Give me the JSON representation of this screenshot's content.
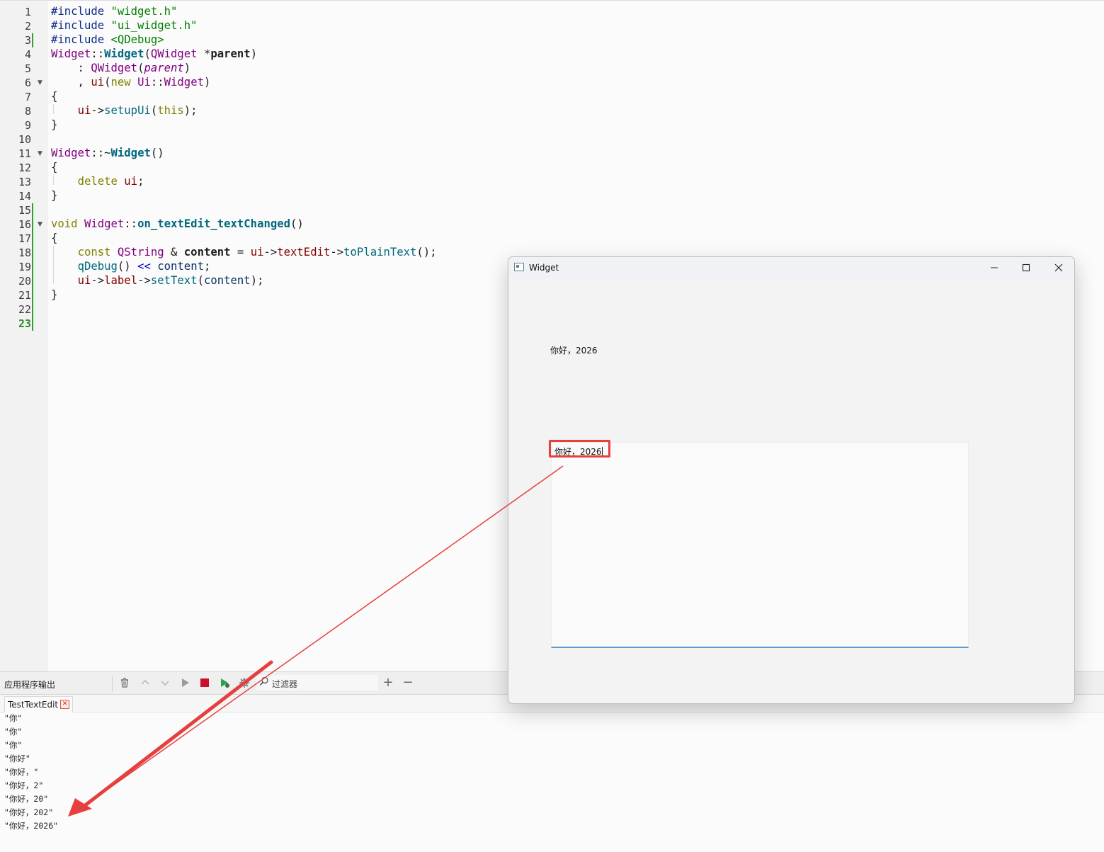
{
  "editor": {
    "line_numbers": [
      "1",
      "2",
      "3",
      "4",
      "5",
      "6",
      "7",
      "8",
      "9",
      "10",
      "11",
      "12",
      "13",
      "14",
      "15",
      "16",
      "17",
      "18",
      "19",
      "20",
      "21",
      "22",
      "23"
    ],
    "lines": [
      [
        {
          "t": "#include ",
          "c": "pp"
        },
        {
          "t": "\"widget.h\"",
          "c": "str"
        }
      ],
      [
        {
          "t": "#include ",
          "c": "pp"
        },
        {
          "t": "\"ui_widget.h\"",
          "c": "str"
        }
      ],
      [
        {
          "t": "#include ",
          "c": "pp"
        },
        {
          "t": "<QDebug>",
          "c": "str"
        }
      ],
      [
        {
          "t": "Widget",
          "c": "cls"
        },
        {
          "t": "::"
        },
        {
          "t": "Widget",
          "c": "fn"
        },
        {
          "t": "("
        },
        {
          "t": "QWidget",
          "c": "cls"
        },
        {
          "t": " *"
        },
        {
          "t": "parent",
          "c": "bold"
        },
        {
          "t": ")"
        }
      ],
      [
        {
          "t": "    : "
        },
        {
          "t": "QWidget",
          "c": "cls"
        },
        {
          "t": "("
        },
        {
          "t": "parent",
          "c": "par"
        },
        {
          "t": ")"
        }
      ],
      [
        {
          "t": "    , "
        },
        {
          "t": "ui",
          "c": "mem"
        },
        {
          "t": "("
        },
        {
          "t": "new",
          "c": "kw"
        },
        {
          "t": " "
        },
        {
          "t": "Ui",
          "c": "cls"
        },
        {
          "t": "::"
        },
        {
          "t": "Widget",
          "c": "cls"
        },
        {
          "t": ")"
        }
      ],
      [
        {
          "t": "{"
        }
      ],
      [
        {
          "t": "    "
        },
        {
          "t": "ui",
          "c": "mem"
        },
        {
          "t": "->"
        },
        {
          "t": "setupUi",
          "c": "fnc"
        },
        {
          "t": "("
        },
        {
          "t": "this",
          "c": "kw"
        },
        {
          "t": ");"
        }
      ],
      [
        {
          "t": "}"
        }
      ],
      [
        {
          "t": ""
        }
      ],
      [
        {
          "t": "Widget",
          "c": "cls"
        },
        {
          "t": "::~"
        },
        {
          "t": "Widget",
          "c": "fn"
        },
        {
          "t": "()"
        }
      ],
      [
        {
          "t": "{"
        }
      ],
      [
        {
          "t": "    "
        },
        {
          "t": "delete",
          "c": "kw"
        },
        {
          "t": " "
        },
        {
          "t": "ui",
          "c": "mem"
        },
        {
          "t": ";"
        }
      ],
      [
        {
          "t": "}"
        }
      ],
      [
        {
          "t": ""
        }
      ],
      [
        {
          "t": "void",
          "c": "kw"
        },
        {
          "t": " "
        },
        {
          "t": "Widget",
          "c": "cls"
        },
        {
          "t": "::"
        },
        {
          "t": "on_textEdit_textChanged",
          "c": "fn"
        },
        {
          "t": "()"
        }
      ],
      [
        {
          "t": "{"
        }
      ],
      [
        {
          "t": "    "
        },
        {
          "t": "const",
          "c": "kw"
        },
        {
          "t": " "
        },
        {
          "t": "QString",
          "c": "cls"
        },
        {
          "t": " & "
        },
        {
          "t": "content",
          "c": "bold"
        },
        {
          "t": " = "
        },
        {
          "t": "ui",
          "c": "mem"
        },
        {
          "t": "->"
        },
        {
          "t": "textEdit",
          "c": "mem"
        },
        {
          "t": "->"
        },
        {
          "t": "toPlainText",
          "c": "fnc"
        },
        {
          "t": "();"
        }
      ],
      [
        {
          "t": "    "
        },
        {
          "t": "qDebug",
          "c": "fnc"
        },
        {
          "t": "() "
        },
        {
          "t": "<<",
          "c": "op"
        },
        {
          "t": " "
        },
        {
          "t": "content",
          "c": "loc"
        },
        {
          "t": ";"
        }
      ],
      [
        {
          "t": "    "
        },
        {
          "t": "ui",
          "c": "mem"
        },
        {
          "t": "->"
        },
        {
          "t": "label",
          "c": "mem"
        },
        {
          "t": "->"
        },
        {
          "t": "setText",
          "c": "fnc"
        },
        {
          "t": "("
        },
        {
          "t": "content",
          "c": "loc"
        },
        {
          "t": ");"
        }
      ],
      [
        {
          "t": "}"
        }
      ],
      [
        {
          "t": ""
        }
      ],
      [
        {
          "t": ""
        }
      ]
    ]
  },
  "output": {
    "pane_title": "应用程序输出",
    "filter_placeholder": "过滤器",
    "tab_label": "TestTextEdit",
    "tab_close": "✕",
    "lines": [
      "\"你\"",
      "\"你\"",
      "\"你\"",
      "\"你好\"",
      "\"你好，\"",
      "\"你好，2\"",
      "\"你好，20\"",
      "\"你好，202\"",
      "\"你好，2026\""
    ]
  },
  "widget_window": {
    "title": "Widget",
    "label_text": "你好，2026",
    "textedit_value": "你好，2026",
    "controls": {
      "minimize": "—",
      "maximize": "☐",
      "close": "✕"
    }
  },
  "colors": {
    "annotation": "#e5403f",
    "modified_marker": "#2fa02f",
    "stop_button": "#c8102e",
    "focus_underline": "#5b9bd5"
  }
}
